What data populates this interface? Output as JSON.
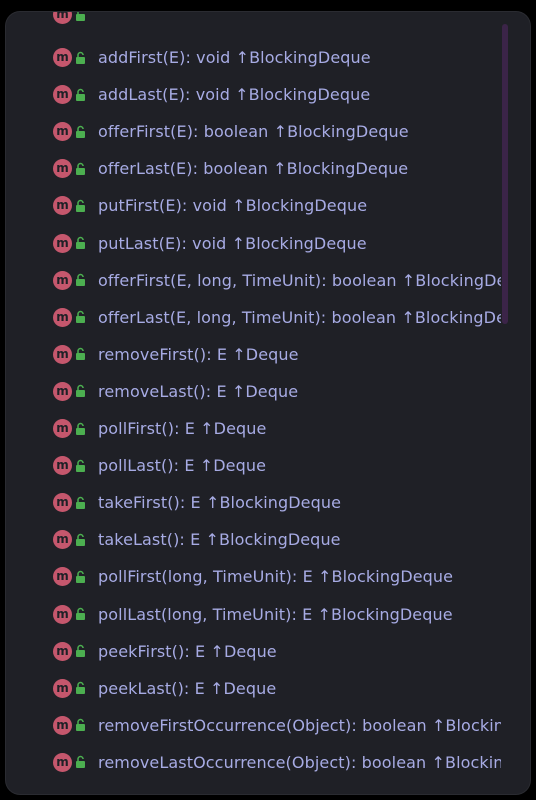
{
  "method_icon_letter": "m",
  "items": [
    {
      "label": "addFirst(E): void ↑BlockingDeque"
    },
    {
      "label": "addLast(E): void ↑BlockingDeque"
    },
    {
      "label": "offerFirst(E): boolean ↑BlockingDeque"
    },
    {
      "label": "offerLast(E): boolean ↑BlockingDeque"
    },
    {
      "label": "putFirst(E): void ↑BlockingDeque"
    },
    {
      "label": "putLast(E): void ↑BlockingDeque"
    },
    {
      "label": "offerFirst(E, long, TimeUnit): boolean ↑BlockingDeque"
    },
    {
      "label": "offerLast(E, long, TimeUnit): boolean ↑BlockingDeque"
    },
    {
      "label": "removeFirst(): E ↑Deque"
    },
    {
      "label": "removeLast(): E ↑Deque"
    },
    {
      "label": "pollFirst(): E ↑Deque"
    },
    {
      "label": "pollLast(): E ↑Deque"
    },
    {
      "label": "takeFirst(): E ↑BlockingDeque"
    },
    {
      "label": "takeLast(): E ↑BlockingDeque"
    },
    {
      "label": "pollFirst(long, TimeUnit): E ↑BlockingDeque"
    },
    {
      "label": "pollLast(long, TimeUnit): E ↑BlockingDeque"
    },
    {
      "label": "peekFirst(): E ↑Deque"
    },
    {
      "label": "peekLast(): E ↑Deque"
    },
    {
      "label": "removeFirstOccurrence(Object): boolean ↑BlockingDeque"
    },
    {
      "label": "removeLastOccurrence(Object): boolean ↑BlockingDeque"
    }
  ],
  "colors": {
    "panel_background": "#1f2026",
    "method_icon": "#c5576d",
    "lock_icon": "#4caf50",
    "label_text": "#a7abe4",
    "scrollbar_thumb": "#3b2448"
  },
  "icons": {
    "method": "method-icon",
    "visibility": "public-lock-icon"
  }
}
